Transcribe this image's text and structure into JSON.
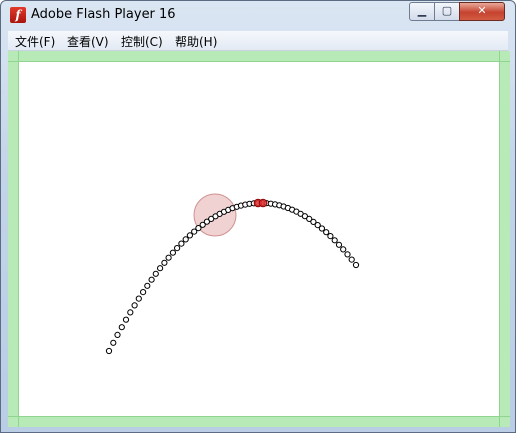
{
  "window": {
    "title": "Adobe Flash Player 16",
    "icon": "flash-player-icon",
    "minimize_icon": "minimize-icon",
    "maximize_icon": "maximize-icon",
    "close_icon": "close-icon"
  },
  "menu": {
    "items": [
      {
        "label": "文件(F)"
      },
      {
        "label": "查看(V)"
      },
      {
        "label": "控制(C)"
      },
      {
        "label": "帮助(H)"
      }
    ]
  },
  "stage": {
    "colors": {
      "border": "#b7eab7",
      "point_stroke": "#000000",
      "highlight": "#e03030",
      "circle_fill": "#e8b4b4"
    }
  }
}
